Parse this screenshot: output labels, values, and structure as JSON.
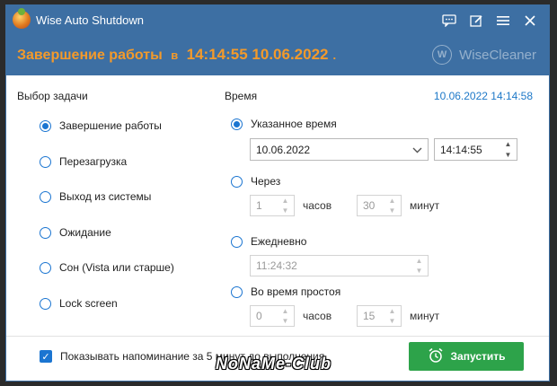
{
  "app": {
    "title": "Wise Auto Shutdown"
  },
  "header": {
    "action_label": "Завершение работы",
    "in_label": "в",
    "scheduled_datetime": "14:14:55 10.06.2022",
    "trailing_dot": ".",
    "brand": "WiseCleaner"
  },
  "titlebar_icons": [
    "message-icon",
    "edit-icon",
    "menu-icon",
    "close-icon"
  ],
  "task": {
    "title": "Выбор задачи",
    "options": [
      {
        "label": "Завершение работы",
        "checked": true
      },
      {
        "label": "Перезагрузка",
        "checked": false
      },
      {
        "label": "Выход из системы",
        "checked": false
      },
      {
        "label": "Ожидание",
        "checked": false
      },
      {
        "label": "Сон (Vista или старше)",
        "checked": false
      },
      {
        "label": "Lock screen",
        "checked": false
      }
    ]
  },
  "time": {
    "title": "Время",
    "current": "10.06.2022 14:14:58",
    "specified": {
      "label": "Указанное время",
      "checked": true,
      "date": "10.06.2022",
      "time": "14:14:55"
    },
    "after": {
      "label": "Через",
      "checked": false,
      "hours": "1",
      "hours_unit": "часов",
      "minutes": "30",
      "minutes_unit": "минут"
    },
    "daily": {
      "label": "Ежедневно",
      "checked": false,
      "time": "11:24:32"
    },
    "idle": {
      "label": "Во время простоя",
      "checked": false,
      "hours": "0",
      "hours_unit": "часов",
      "minutes": "15",
      "minutes_unit": "минут"
    }
  },
  "footer": {
    "reminder": "Показывать напоминание за 5 минут до выполнения.",
    "reminder_checked": true,
    "start_button": "Запустить"
  },
  "watermark": "NoNaMe-Club",
  "colors": {
    "header_bg": "#3d6fa3",
    "accent_orange": "#f39a2b",
    "radio_blue": "#1b75d1",
    "clock_blue": "#1d78c8",
    "start_green": "#2da34a"
  }
}
